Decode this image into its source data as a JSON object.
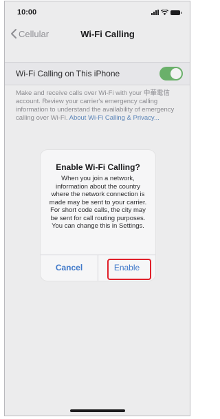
{
  "status_bar": {
    "time": "10:00"
  },
  "nav": {
    "back_label": "Cellular",
    "title": "Wi-Fi Calling"
  },
  "setting": {
    "label": "Wi-Fi Calling on This iPhone",
    "enabled": true,
    "toggle_color": "#6ab06a"
  },
  "description": {
    "text": "Make and receive calls over Wi-Fi with your 中華電信 account. Review your carrier's emergency calling information to understand the availability of emergency calling over Wi-Fi. ",
    "link": "About Wi-Fi Calling & Privacy..."
  },
  "dialog": {
    "title": "Enable Wi-Fi Calling?",
    "message": "When you join a network, information about the country where the network connection is made may be sent to your carrier. For short code calls, the city may be sent for call routing purposes. You can change this in Settings.",
    "cancel_label": "Cancel",
    "enable_label": "Enable",
    "button_color": "#3f78c9",
    "highlight_color": "#e0202a"
  }
}
